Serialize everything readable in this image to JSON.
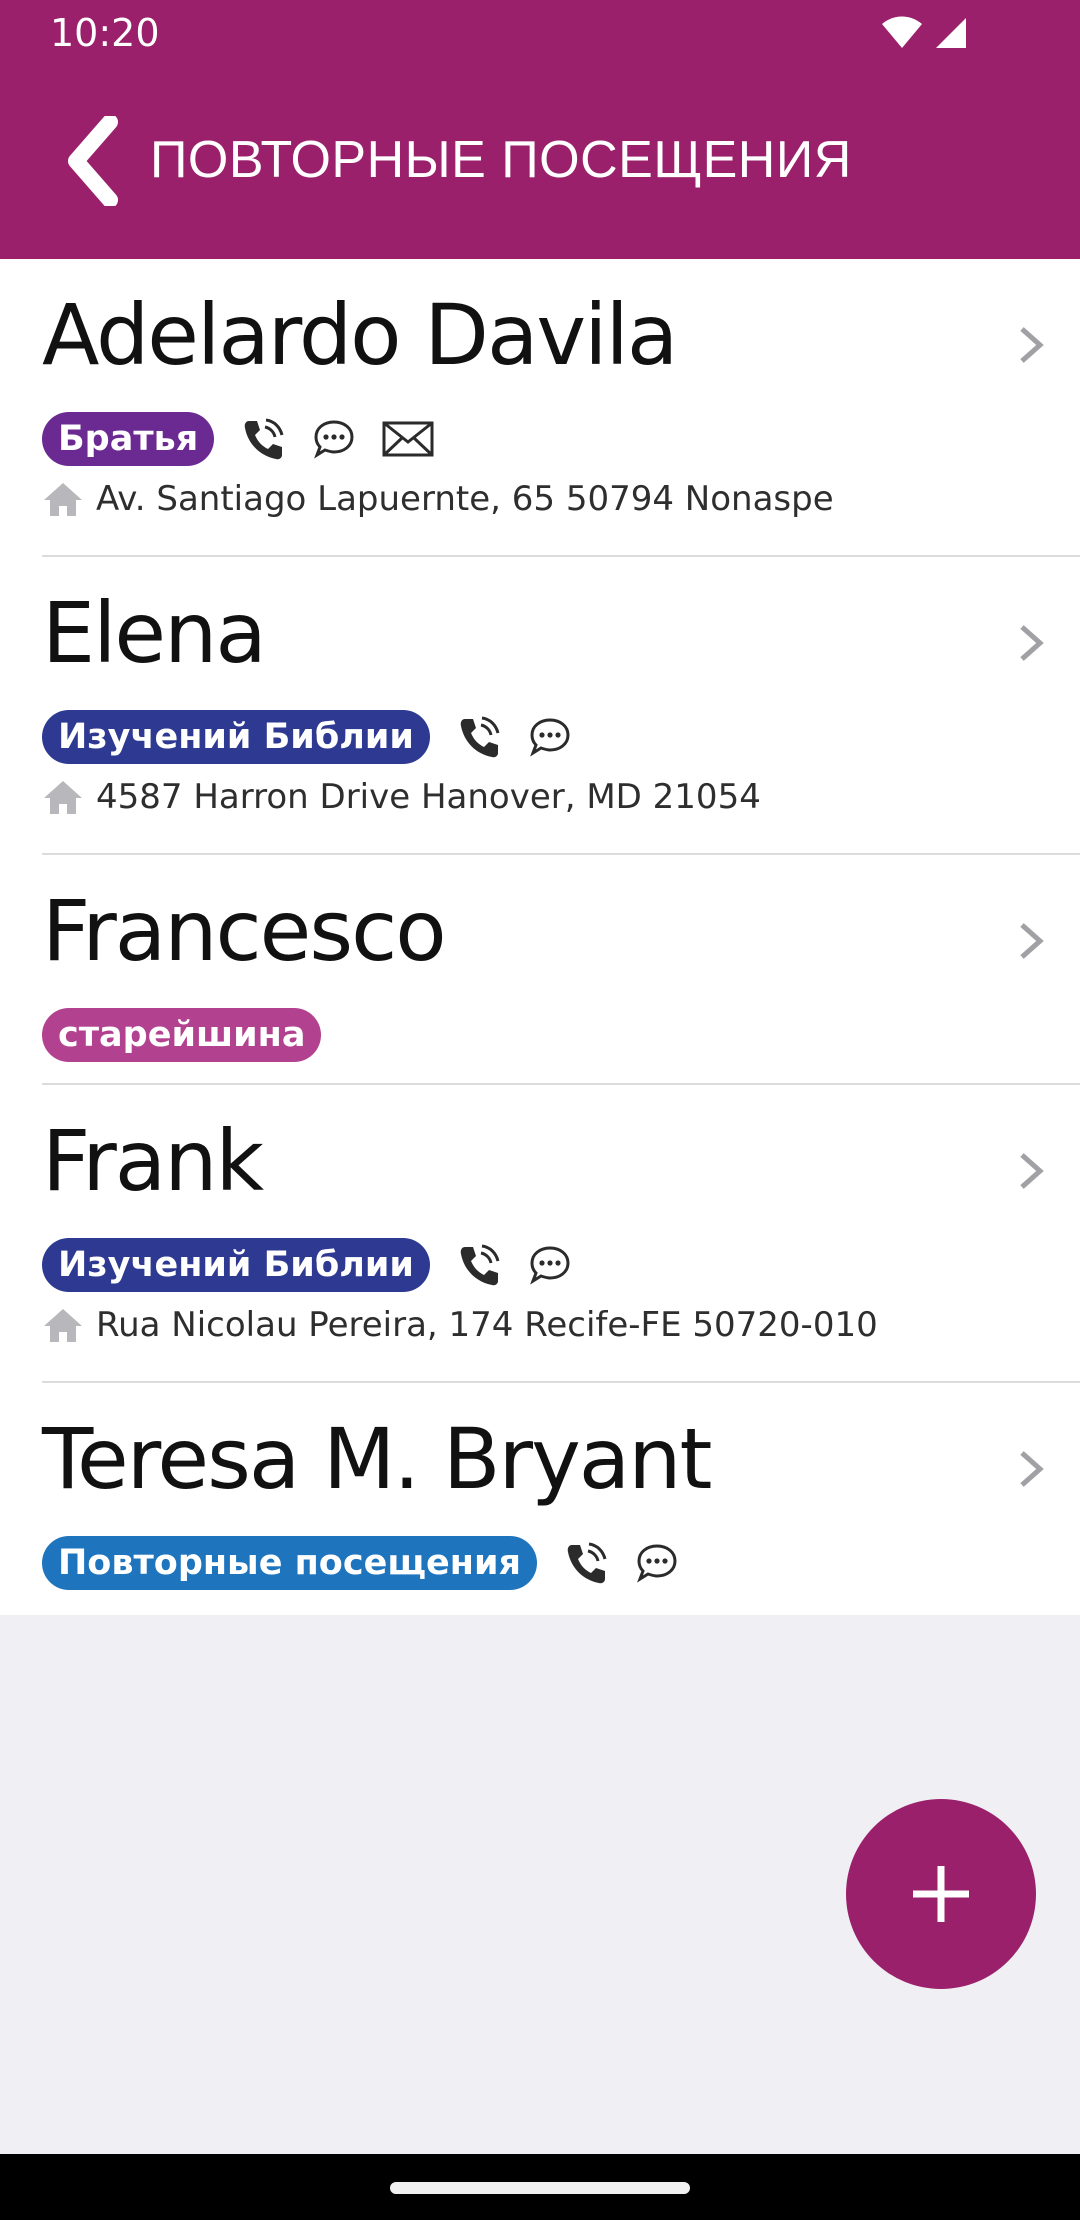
{
  "status_bar": {
    "time": "10:20",
    "icons": [
      "wifi-icon",
      "signal-icon"
    ]
  },
  "header": {
    "back_icon": "chevron-left-icon",
    "title": "ПОВТОРНЫЕ ПОСЕЩЕНИЯ"
  },
  "contacts": [
    {
      "name": "Adelardo Davila",
      "badge": "Братья",
      "badge_color": "#6b2a91",
      "icons": [
        "phone-icon",
        "chat-icon",
        "mail-icon"
      ],
      "address": "Av. Santiago Lapuernte, 65 50794 Nonaspe"
    },
    {
      "name": "Elena",
      "badge": "Изучений Библии",
      "badge_color": "#2e3a91",
      "icons": [
        "phone-icon",
        "chat-icon"
      ],
      "address": "4587 Harron Drive Hanover, MD 21054"
    },
    {
      "name": "Francesco",
      "badge": "старейшина",
      "badge_color": "#b2418f",
      "icons": [],
      "address": ""
    },
    {
      "name": "Frank",
      "badge": "Изучений Библии",
      "badge_color": "#2e3a91",
      "icons": [
        "phone-icon",
        "chat-icon"
      ],
      "address": "Rua Nicolau Pereira, 174 Recife-FE 50720-010"
    },
    {
      "name": "Teresa M. Bryant",
      "badge": "Повторные посещения",
      "badge_color": "#1e74bd",
      "icons": [
        "phone-icon",
        "chat-icon"
      ],
      "address": ""
    }
  ],
  "fab": {
    "icon": "plus-icon"
  },
  "colors": {
    "brand": "#9b206b",
    "background": "#efeff4"
  }
}
